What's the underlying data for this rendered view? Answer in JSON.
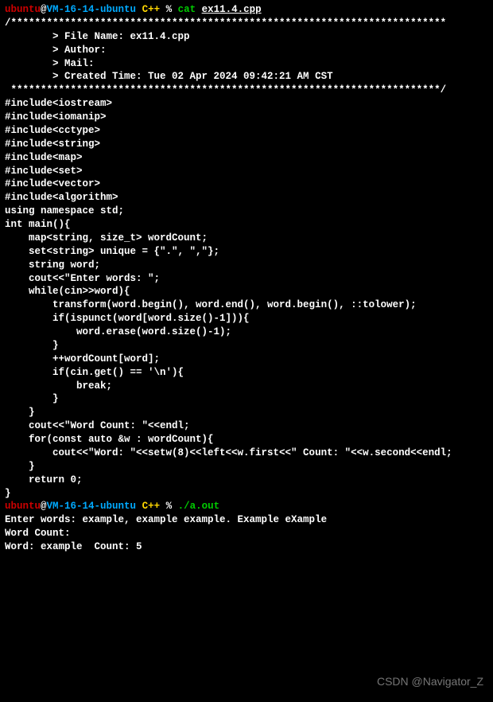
{
  "prompt1": {
    "user": "ubuntu",
    "at": "@",
    "host": "VM-16-14-ubuntu",
    "dir": " C++ ",
    "pct": "% ",
    "cmd": "cat ",
    "arg": "ex11.4.cpp"
  },
  "header": {
    "top": "/*************************************************************************",
    "file": "        > File Name: ex11.4.cpp",
    "author": "        > Author:",
    "mail": "        > Mail:",
    "time": "        > Created Time: Tue 02 Apr 2024 09:42:21 AM CST",
    "bot": " ************************************************************************/"
  },
  "blank": "",
  "code": {
    "l01": "#include<iostream>",
    "l02": "#include<iomanip>",
    "l03": "#include<cctype>",
    "l04": "#include<string>",
    "l05": "#include<map>",
    "l06": "#include<set>",
    "l07": "#include<vector>",
    "l08": "#include<algorithm>",
    "l09": "using namespace std;",
    "l10": "",
    "l11": "int main(){",
    "l12": "    map<string, size_t> wordCount;",
    "l13": "    set<string> unique = {\".\", \",\"};",
    "l14": "    string word;",
    "l15": "",
    "l16": "    cout<<\"Enter words: \";",
    "l17": "    while(cin>>word){",
    "l18": "        transform(word.begin(), word.end(), word.begin(), ::tolower);",
    "l19": "        if(ispunct(word[word.size()-1])){",
    "l20": "            word.erase(word.size()-1);",
    "l21": "        }",
    "l22": "        ++wordCount[word];",
    "l23": "        if(cin.get() == '\\n'){",
    "l24": "            break;",
    "l25": "        }",
    "l26": "    }",
    "l27": "",
    "l28": "    cout<<\"Word Count: \"<<endl;",
    "l29": "    for(const auto &w : wordCount){",
    "l30": "        cout<<\"Word: \"<<setw(8)<<left<<w.first<<\" Count: \"<<w.second<<endl;",
    "l31": "    }",
    "l32": "",
    "l33": "    return 0;",
    "l34": "}"
  },
  "prompt2": {
    "user": "ubuntu",
    "at": "@",
    "host": "VM-16-14-ubuntu",
    "dir": " C++ ",
    "pct": "% ",
    "cmd": "./a.out"
  },
  "out": {
    "l1": "Enter words: example, example example. Example eXample",
    "l2": "Word Count:",
    "l3": "Word: example  Count: 5"
  },
  "watermark": "CSDN @Navigator_Z"
}
